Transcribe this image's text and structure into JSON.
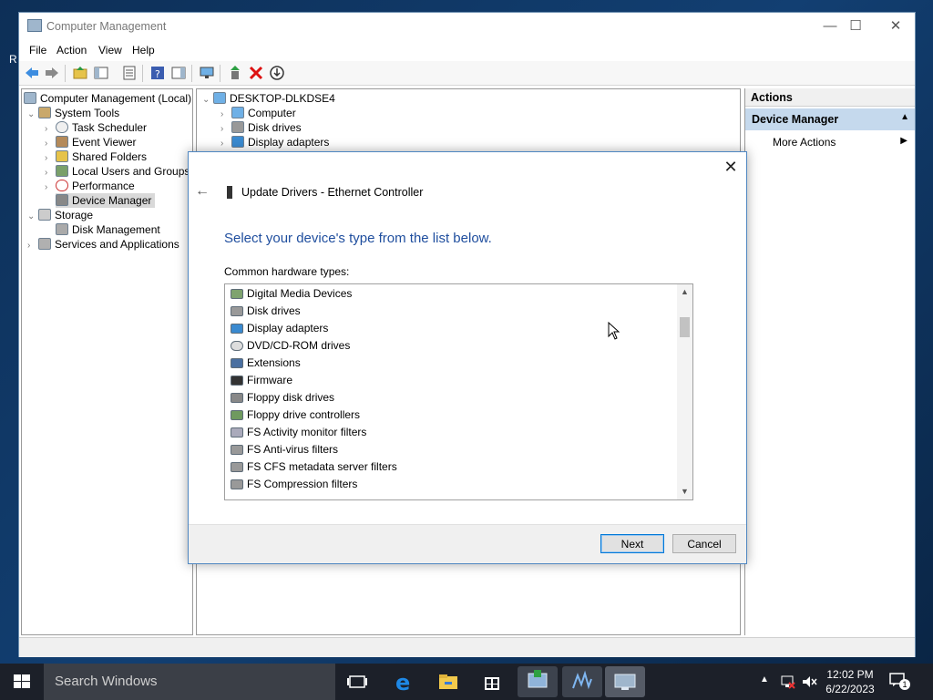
{
  "window": {
    "title": "Computer Management",
    "controls": {
      "minimize": "—",
      "maximize": "☐",
      "close": "✕"
    }
  },
  "menu": [
    "File",
    "Action",
    "View",
    "Help"
  ],
  "tree": {
    "items": [
      {
        "label": "Computer Management (Local)",
        "depth": 0,
        "expander": ""
      },
      {
        "label": "System Tools",
        "depth": 1,
        "expander": "⌄"
      },
      {
        "label": "Task Scheduler",
        "depth": 2,
        "expander": "›"
      },
      {
        "label": "Event Viewer",
        "depth": 2,
        "expander": "›"
      },
      {
        "label": "Shared Folders",
        "depth": 2,
        "expander": "›"
      },
      {
        "label": "Local Users and Groups",
        "depth": 2,
        "expander": "›"
      },
      {
        "label": "Performance",
        "depth": 2,
        "expander": "›"
      },
      {
        "label": "Device Manager",
        "depth": 2,
        "expander": "",
        "selected": true
      },
      {
        "label": "Storage",
        "depth": 1,
        "expander": "⌄"
      },
      {
        "label": "Disk Management",
        "depth": 2,
        "expander": ""
      },
      {
        "label": "Services and Applications",
        "depth": 1,
        "expander": "›"
      }
    ]
  },
  "center": {
    "root": "DESKTOP-DLKDSE4",
    "items": [
      "Computer",
      "Disk drives",
      "Display adapters"
    ]
  },
  "actions": {
    "header": "Actions",
    "section": "Device Manager",
    "item": "More Actions"
  },
  "dialog": {
    "title": "Update Drivers - Ethernet Controller",
    "heading": "Select your device's type from the list below.",
    "label": "Common hardware types:",
    "list": [
      "Digital Media Devices",
      "Disk drives",
      "Display adapters",
      "DVD/CD-ROM drives",
      "Extensions",
      "Firmware",
      "Floppy disk drives",
      "Floppy drive controllers",
      "FS Activity monitor filters",
      "FS Anti-virus filters",
      "FS CFS metadata server filters",
      "FS Compression filters"
    ],
    "buttons": {
      "next": "Next",
      "cancel": "Cancel"
    },
    "close": "✕",
    "back": "←"
  },
  "taskbar": {
    "search_placeholder": "Search Windows",
    "time": "12:02 PM",
    "date": "6/22/2023",
    "notification_count": "1"
  },
  "desktop_fragment": "R"
}
